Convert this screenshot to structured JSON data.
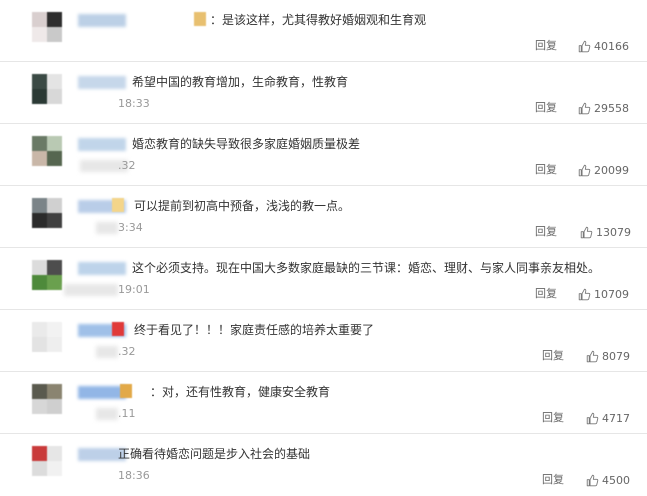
{
  "comments": [
    {
      "avatar_colors": [
        "#d9cfcf",
        "#2e2e2e",
        "#efe9e9",
        "#c9c9c9"
      ],
      "name_color": "#bcd0e6",
      "has_badge": true,
      "badge_color": "#e8c070",
      "prefix": "：",
      "text": "是该这样，尤其得教好婚姻观和生育观",
      "time": "",
      "reply_label": "回复",
      "likes": "40166"
    },
    {
      "avatar_colors": [
        "#3b4a45",
        "#e4e4e4",
        "#2b3a35",
        "#d8d8d8"
      ],
      "name_color": "#c6d7ea",
      "has_badge": false,
      "badge_color": "",
      "prefix": "",
      "text": "希望中国的教育增加，生命教育，性教育",
      "time": "18:33",
      "reply_label": "回复",
      "likes": "29558"
    },
    {
      "avatar_colors": [
        "#6a7a66",
        "#b9c9b3",
        "#c9b7a8",
        "#566650"
      ],
      "name_color": "#c1d5ea",
      "has_badge": false,
      "badge_color": "",
      "prefix": "",
      "text": "婚恋教育的缺失导致很多家庭婚姻质量极差",
      "time": ".32",
      "reply_label": "回复",
      "likes": "20099"
    },
    {
      "avatar_colors": [
        "#7b8488",
        "#d0d0d0",
        "#2b2b2b",
        "#404040"
      ],
      "name_color": "#b9cde8",
      "has_badge": true,
      "badge_color": "#f4d58a",
      "prefix": "",
      "text": "可以提前到初高中预备，浅浅的教一点。",
      "time": "3:34",
      "reply_label": "回复",
      "likes": "13079"
    },
    {
      "avatar_colors": [
        "#dcdcdc",
        "#4d4d4d",
        "#4e8a3b",
        "#6aa04e"
      ],
      "name_color": "#bdd3ea",
      "has_badge": false,
      "badge_color": "",
      "prefix": "",
      "text": "这个必须支持。现在中国大多数家庭最缺的三节课：婚恋、理财、与家人同事亲友相处。",
      "time": "19:01",
      "reply_label": "回复",
      "likes": "10709"
    },
    {
      "avatar_colors": [
        "#eaeaea",
        "#f2f2f2",
        "#e3e3e3",
        "#eeeeee"
      ],
      "name_color": "#9fc0e8",
      "has_badge": true,
      "badge_color": "#e03a3a",
      "prefix": "",
      "text": "终于看见了！！！家庭责任感的培养太重要了",
      "time": ".32",
      "reply_label": "回复",
      "likes": "8079"
    },
    {
      "avatar_colors": [
        "#5a5a4e",
        "#8a8470",
        "#d7d7d7",
        "#cfcfcf"
      ],
      "name_color": "#92b6e6",
      "has_badge": true,
      "badge_color": "#e2a948",
      "prefix": "：",
      "text": "对，还有性教育，健康安全教育",
      "time": ".11",
      "reply_label": "回复",
      "likes": "4717"
    },
    {
      "avatar_colors": [
        "#c93b3b",
        "#e6e6e6",
        "#dcdcdc",
        "#f1f1f1"
      ],
      "name_color": "#bdd0e8",
      "has_badge": false,
      "badge_color": "",
      "prefix": "",
      "text": "正确看待婚恋问题是步入社会的基础",
      "time": "18:36",
      "reply_label": "回复",
      "likes": "4500"
    }
  ]
}
